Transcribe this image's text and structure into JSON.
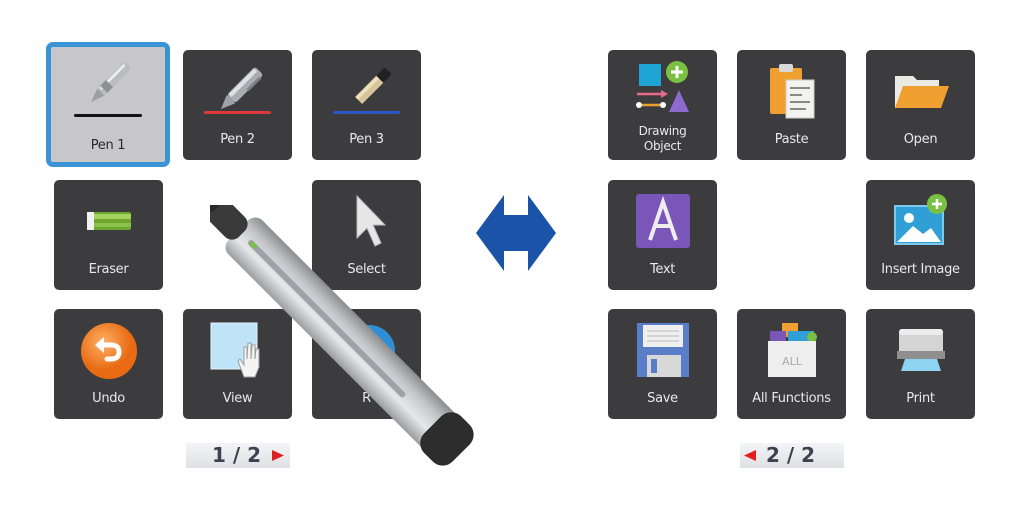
{
  "left_panel": {
    "tiles": [
      {
        "label": "Pen 1",
        "icon": "fountain-pen-icon",
        "stroke_color": "#111111",
        "selected": true
      },
      {
        "label": "Pen 2",
        "icon": "metal-pen-icon",
        "stroke_color": "#e0373a",
        "selected": false
      },
      {
        "label": "Pen 3",
        "icon": "wooden-pen-icon",
        "stroke_color": "#2b56c4",
        "selected": false
      },
      {
        "label": "Eraser",
        "icon": "eraser-icon"
      },
      {
        "label": "Select",
        "icon": "cursor-arrow-icon"
      },
      {
        "label": "Undo",
        "icon": "undo-icon"
      },
      {
        "label": "View",
        "icon": "view-hand-icon"
      },
      {
        "label": "R",
        "icon": "blue-circle-icon"
      }
    ],
    "pager": {
      "text": "1 / 2",
      "arrow": "next-arrow-icon",
      "arrow_color": "#e02020"
    }
  },
  "swap_icon": {
    "name": "double-arrow-icon",
    "color": "#1a53a8"
  },
  "right_panel": {
    "tiles": [
      {
        "label_line1": "Drawing",
        "label_line2": "Object",
        "icon": "drawing-object-icon"
      },
      {
        "label": "Paste",
        "icon": "clipboard-icon"
      },
      {
        "label": "Open",
        "icon": "folder-icon"
      },
      {
        "label": "Text",
        "icon": "text-a-icon"
      },
      {
        "label": "Insert Image",
        "icon": "insert-image-icon"
      },
      {
        "label": "Save",
        "icon": "floppy-disk-icon"
      },
      {
        "label": "All Functions",
        "icon": "all-functions-icon",
        "icon_text": "ALL"
      },
      {
        "label": "Print",
        "icon": "printer-icon"
      }
    ],
    "pager": {
      "text": "2 / 2",
      "arrow": "prev-arrow-icon",
      "arrow_color": "#e02020"
    }
  },
  "device": {
    "name": "interactive-pen"
  }
}
